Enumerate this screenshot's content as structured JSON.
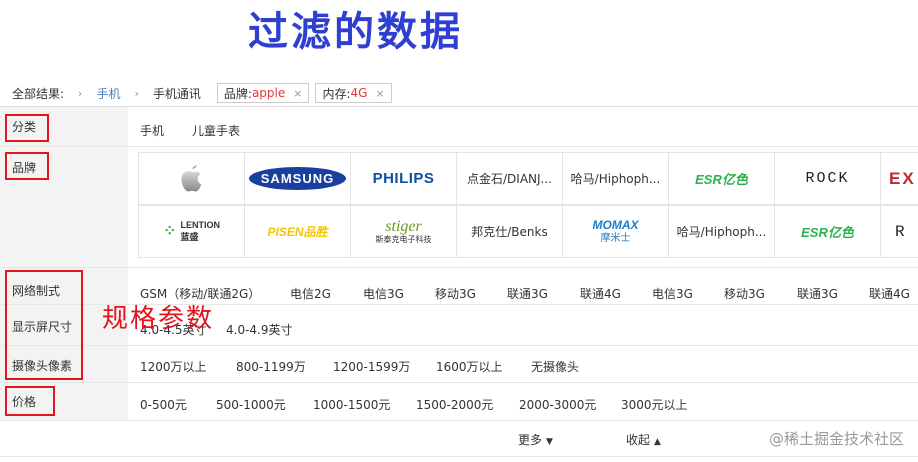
{
  "heading": "过滤的数据",
  "breadcrumb": {
    "all_results": "全部结果:",
    "arrow": "›",
    "category": "手机",
    "subcategory": "手机通讯",
    "tags": [
      {
        "key": "品牌:",
        "value": "apple",
        "close": "×"
      },
      {
        "key": "内存:",
        "value": "4G",
        "close": "×"
      }
    ]
  },
  "filters": {
    "category": {
      "label": "分类",
      "values": [
        "手机",
        "儿童手表"
      ]
    },
    "brand": {
      "label": "品牌",
      "row1": [
        "apple-logo",
        "SAMSUNG",
        "PHILIPS",
        "点金石/DIANJ...",
        "哈马/Hiphoph...",
        "ESR亿色",
        "ROCK",
        "EX"
      ],
      "row2": [
        "LENTION",
        "PISEN品胜",
        "stiger",
        "邦克仕/Benks",
        "MOMAX",
        "哈马/Hiphoph...",
        "ESR亿色",
        "R"
      ],
      "lention_sub": "蓝盛",
      "momax_sub": "摩米士",
      "stiger_sub": "斯泰克电子科技"
    },
    "network": {
      "label": "网络制式",
      "values": [
        "GSM（移动/联通2G）",
        "电信2G",
        "电信3G",
        "移动3G",
        "联通3G",
        "联通4G",
        "电信3G",
        "移动3G",
        "联通3G",
        "联通4G"
      ]
    },
    "screen": {
      "label": "显示屏尺寸",
      "values": [
        "4.0-4.5英寸",
        "4.0-4.9英寸"
      ]
    },
    "camera": {
      "label": "摄像头像素",
      "values": [
        "1200万以上",
        "800-1199万",
        "1200-1599万",
        "1600万以上",
        "无摄像头"
      ]
    },
    "price": {
      "label": "价格",
      "values": [
        "0-500元",
        "500-1000元",
        "1000-1500元",
        "1500-2000元",
        "2000-3000元",
        "3000元以上"
      ]
    }
  },
  "annotation_spec": "规格参数",
  "footer": {
    "more": "更多",
    "more_caret": "▼",
    "collapse": "收起",
    "collapse_caret": "▲"
  },
  "watermark": "@稀土掘金技术社区",
  "colors": {
    "accent_red": "#e3141b",
    "heading_blue": "#2f3fd1",
    "tag_value": "#e4393c",
    "link": "#4a7fbf"
  }
}
